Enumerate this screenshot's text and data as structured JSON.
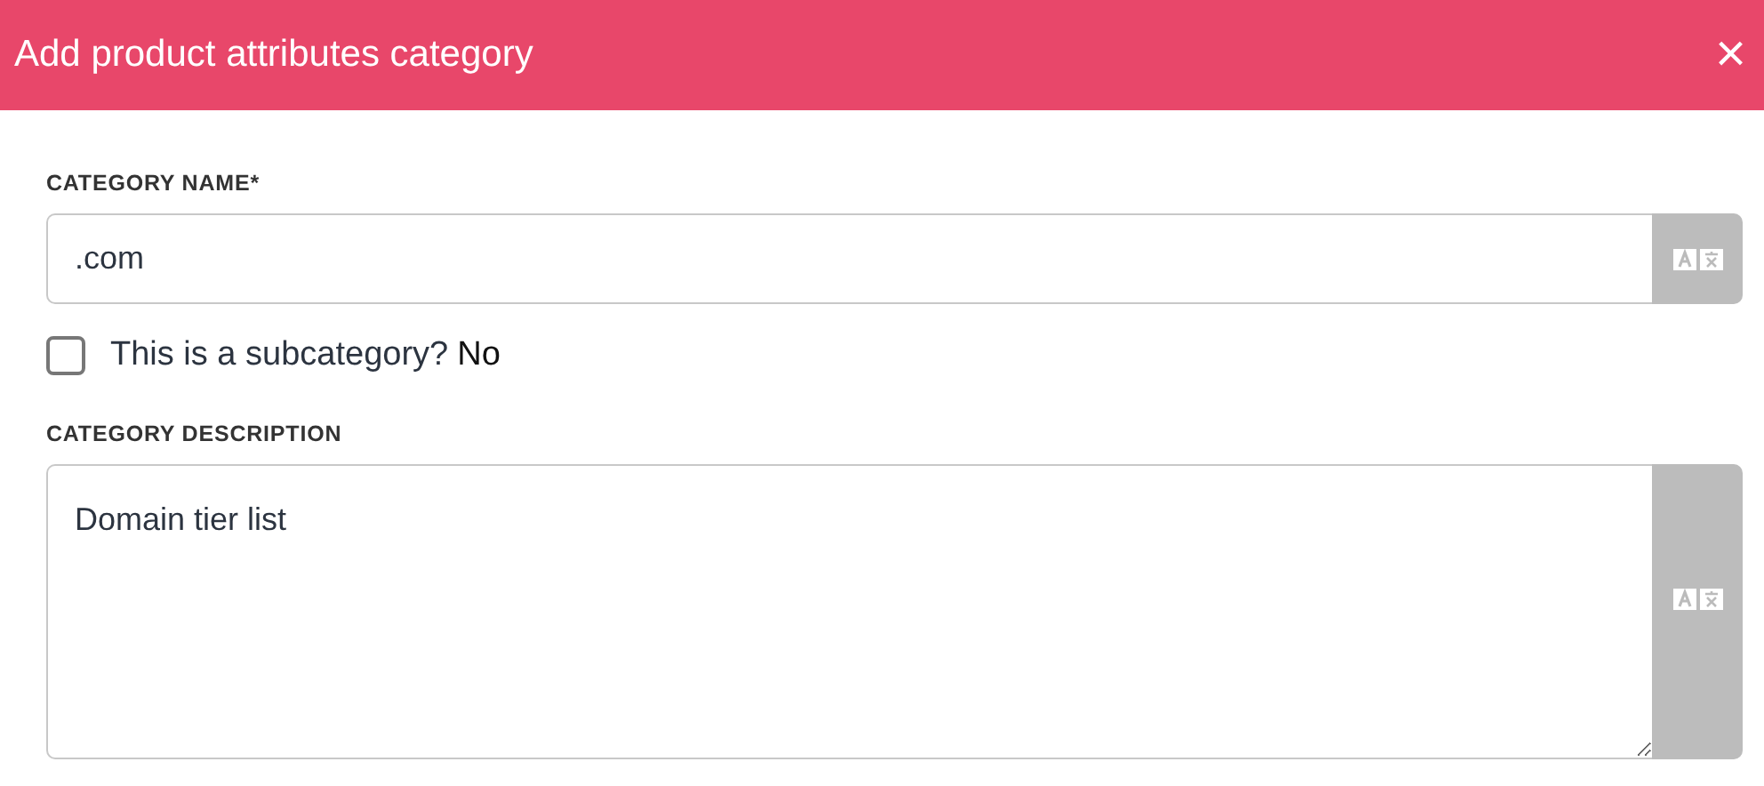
{
  "dialog": {
    "title": "Add product attributes category",
    "close": "×"
  },
  "fields": [
    {
      "kind": "input",
      "label": "CATEGORY NAME*",
      "value": ".com"
    },
    {
      "kind": "checkbox",
      "label": "This is a subcategory?",
      "value": "No",
      "checked": false
    },
    {
      "kind": "textarea",
      "label": "CATEGORY DESCRIPTION",
      "value": "Domain tier list"
    }
  ]
}
